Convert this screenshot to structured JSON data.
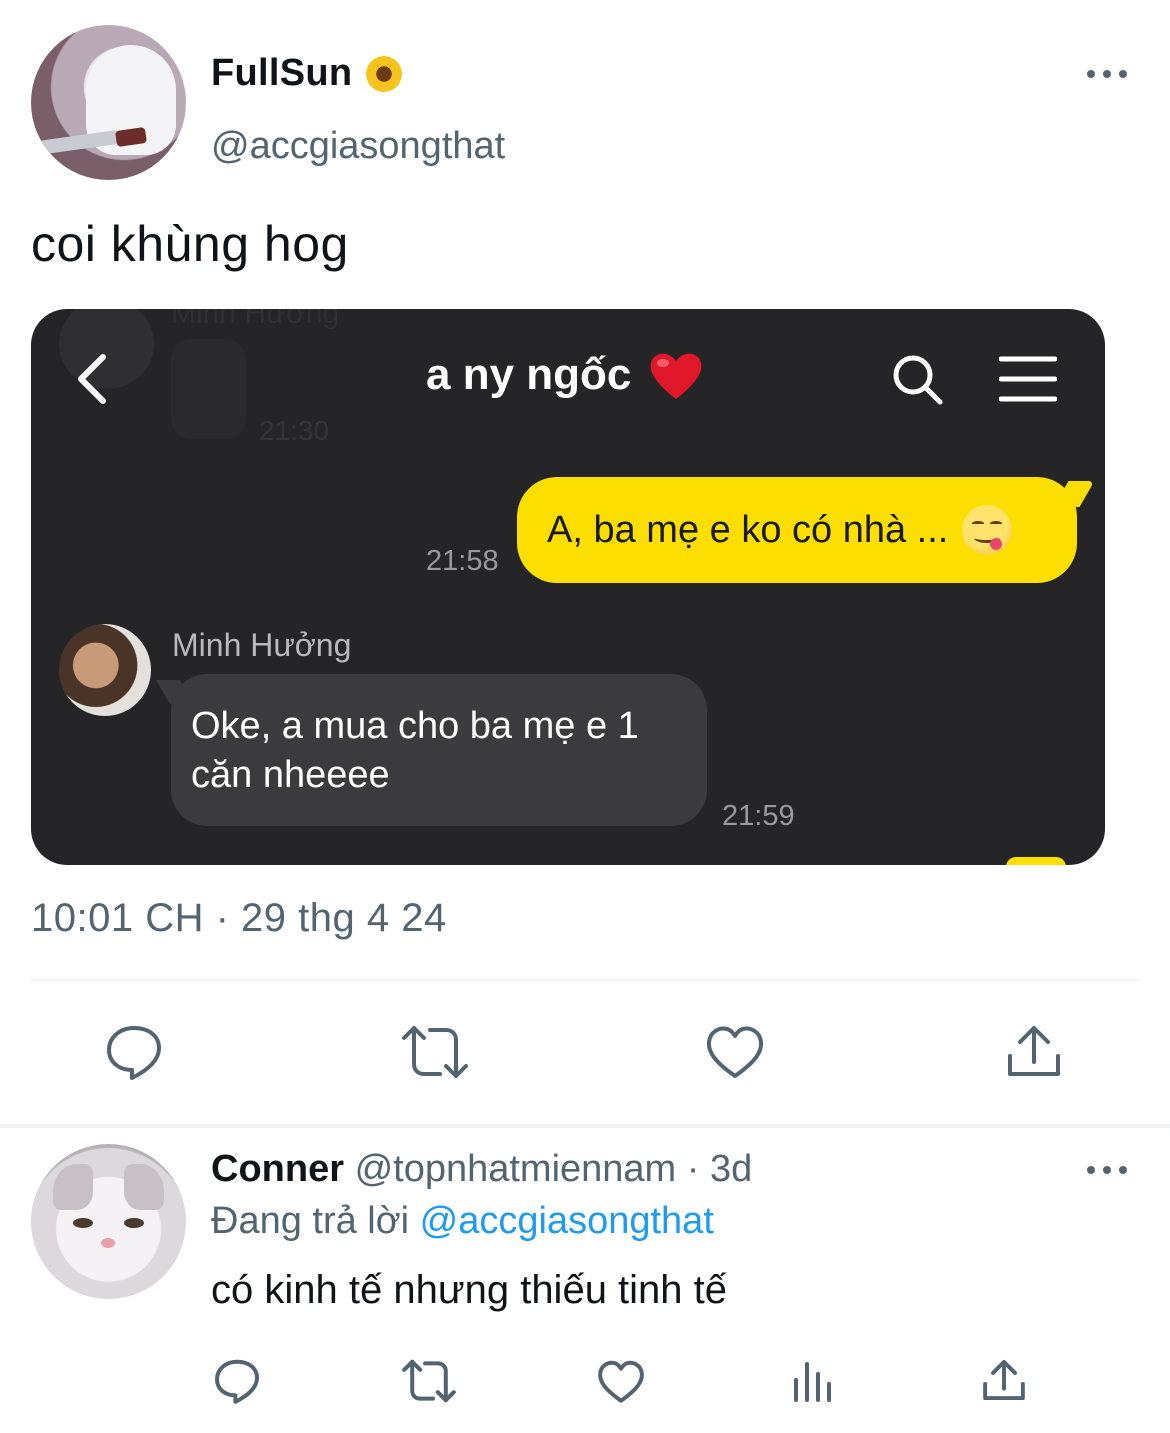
{
  "tweet": {
    "display_name": "FullSun",
    "name_emoji": "sunflower",
    "handle": "@accgiasongthat",
    "text": "coi khùng hog",
    "timestamp": "10:01 CH · 29 thg 4 24"
  },
  "chat_screenshot": {
    "title": "a ny ngốc",
    "title_emoji": "red-heart",
    "ghost_name": "Minh Hưởng",
    "ghost_time": "21:30",
    "outgoing": {
      "text": "A, ba mẹ e ko có nhà ...",
      "emoji": "yum-face",
      "time": "21:58"
    },
    "incoming": {
      "sender": "Minh Hưởng",
      "line1": "Oke, a mua cho ba mẹ e 1",
      "line2": "căn nheeee",
      "time": "21:59"
    },
    "colors": {
      "background": "#252527",
      "outgoing_bubble": "#fcdf00",
      "incoming_bubble": "#3b3b3d"
    }
  },
  "actions_main": [
    "reply-icon",
    "retweet-icon",
    "like-icon",
    "share-icon"
  ],
  "reply": {
    "display_name": "Conner",
    "handle": "@topnhatmiennam",
    "age": "3d",
    "replying_label": "Đang trả lời",
    "replying_to": "@accgiasongthat",
    "text": "có kinh tế nhưng thiếu tinh tế",
    "actions": [
      "reply-icon",
      "retweet-icon",
      "like-icon",
      "views-icon",
      "share-icon"
    ]
  },
  "colors": {
    "text_primary": "#0f1419",
    "text_secondary": "#536471",
    "link": "#1d9bf0",
    "divider": "#eff3f4"
  }
}
